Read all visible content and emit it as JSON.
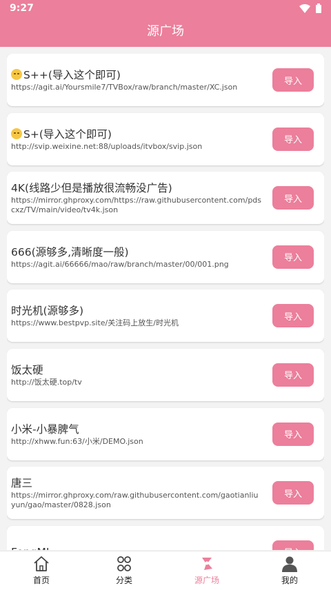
{
  "status": {
    "time": "9:27"
  },
  "header": {
    "title": "源广场"
  },
  "import_label": "导入",
  "sources": [
    {
      "title": "S++(导入这个即可)",
      "emoji": true,
      "url": "https://agit.ai/Yoursmile7/TVBox/raw/branch/master/XC.json"
    },
    {
      "title": "S+(导入这个即可)",
      "emoji": true,
      "url": "http://svip.weixine.net:88/uploads/itvbox/svip.json"
    },
    {
      "title": "4K(线路少但是播放很流畅没广告)",
      "emoji": false,
      "url": "https://mirror.ghproxy.com/https://raw.githubusercontent.com/pdscxz/TV/main/video/tv4k.json"
    },
    {
      "title": "666(源够多,清晰度一般)",
      "emoji": false,
      "url": "https://agit.ai/66666/mao/raw/branch/master/00/001.png"
    },
    {
      "title": "时光机(源够多)",
      "emoji": false,
      "url": "https://www.bestpvp.site/关注码上放生/时光机"
    },
    {
      "title": "饭太硬",
      "emoji": false,
      "url": "http://饭太硬.top/tv"
    },
    {
      "title": "小米-小暴脾气",
      "emoji": false,
      "url": "http://xhww.fun:63/小米/DEMO.json"
    },
    {
      "title": "唐三",
      "emoji": false,
      "url": "https://mirror.ghproxy.com/raw.githubusercontent.com/gaotianliuyun/gao/master/0828.json"
    },
    {
      "title": "FongMI",
      "emoji": false,
      "url": ""
    }
  ],
  "nav": [
    {
      "label": "首页",
      "icon": "home-icon",
      "active": false
    },
    {
      "label": "分类",
      "icon": "category-icon",
      "active": false
    },
    {
      "label": "源广场",
      "icon": "source-square-icon",
      "active": true
    },
    {
      "label": "我的",
      "icon": "profile-icon",
      "active": false
    }
  ],
  "colors": {
    "accent": "#ec7f9b",
    "background": "#f3f3f3"
  }
}
